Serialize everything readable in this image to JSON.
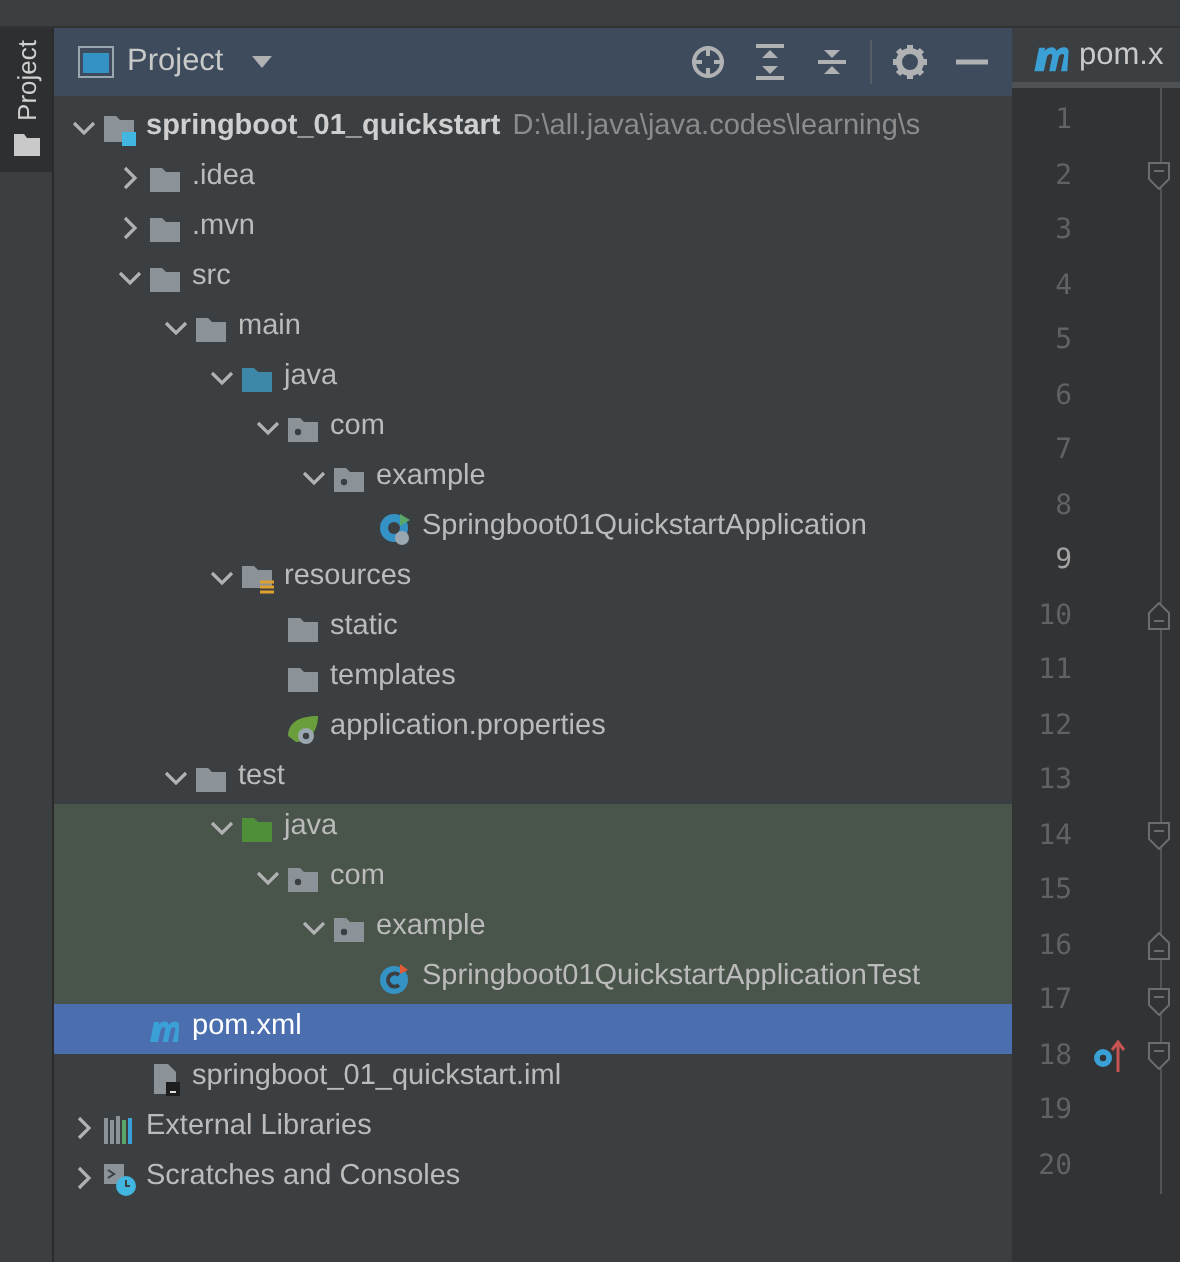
{
  "tool_stripe": {
    "label": "Project"
  },
  "panel": {
    "title": "Project"
  },
  "tree": [
    {
      "kind": "module",
      "label": "springboot_01_quickstart",
      "path": "D:\\all.java\\java.codes\\learning\\s",
      "expanded": true,
      "selected": false,
      "highlighted": false,
      "children": [
        {
          "kind": "folder",
          "label": ".idea",
          "expanded": false,
          "selected": false,
          "highlighted": false
        },
        {
          "kind": "folder",
          "label": ".mvn",
          "expanded": false,
          "selected": false,
          "highlighted": false
        },
        {
          "kind": "folder",
          "label": "src",
          "expanded": true,
          "selected": false,
          "highlighted": false,
          "children": [
            {
              "kind": "folder",
              "label": "main",
              "expanded": true,
              "selected": false,
              "highlighted": false,
              "children": [
                {
                  "kind": "source",
                  "label": "java",
                  "expanded": true,
                  "selected": false,
                  "highlighted": false,
                  "children": [
                    {
                      "kind": "package",
                      "label": "com",
                      "expanded": true,
                      "selected": false,
                      "highlighted": false,
                      "children": [
                        {
                          "kind": "package",
                          "label": "example",
                          "expanded": true,
                          "selected": false,
                          "highlighted": false,
                          "children": [
                            {
                              "kind": "spring-class",
                              "label": "Springboot01QuickstartApplication",
                              "selected": false,
                              "highlighted": false
                            }
                          ]
                        }
                      ]
                    }
                  ]
                },
                {
                  "kind": "resources",
                  "label": "resources",
                  "expanded": true,
                  "selected": false,
                  "highlighted": false,
                  "children": [
                    {
                      "kind": "folder",
                      "label": "static",
                      "selected": false,
                      "highlighted": false
                    },
                    {
                      "kind": "folder",
                      "label": "templates",
                      "selected": false,
                      "highlighted": false
                    },
                    {
                      "kind": "properties",
                      "label": "application.properties",
                      "selected": false,
                      "highlighted": false
                    }
                  ]
                }
              ]
            },
            {
              "kind": "folder",
              "label": "test",
              "expanded": true,
              "selected": false,
              "highlighted": false,
              "children": [
                {
                  "kind": "test-source",
                  "label": "java",
                  "expanded": true,
                  "selected": false,
                  "highlighted": true,
                  "children": [
                    {
                      "kind": "package",
                      "label": "com",
                      "expanded": true,
                      "selected": false,
                      "highlighted": true,
                      "children": [
                        {
                          "kind": "package",
                          "label": "example",
                          "expanded": true,
                          "selected": false,
                          "highlighted": true,
                          "children": [
                            {
                              "kind": "test-class",
                              "label": "Springboot01QuickstartApplicationTest",
                              "selected": false,
                              "highlighted": true
                            }
                          ]
                        }
                      ]
                    }
                  ]
                }
              ]
            }
          ]
        },
        {
          "kind": "maven",
          "label": "pom.xml",
          "selected": true,
          "highlighted": false
        },
        {
          "kind": "iml",
          "label": "springboot_01_quickstart.iml",
          "selected": false,
          "highlighted": false
        }
      ]
    },
    {
      "kind": "libraries",
      "label": "External Libraries",
      "expanded": false,
      "selected": false,
      "highlighted": false
    },
    {
      "kind": "scratches",
      "label": "Scratches and Consoles",
      "expanded": false,
      "selected": false,
      "highlighted": false
    }
  ],
  "editor": {
    "tab": {
      "label": "pom.x"
    },
    "lines": [
      {
        "number": "1",
        "current": false,
        "fold_start": false,
        "fold_end": false,
        "override_marker": false
      },
      {
        "number": "2",
        "current": false,
        "fold_start": true,
        "fold_end": false,
        "override_marker": false
      },
      {
        "number": "3",
        "current": false,
        "fold_start": false,
        "fold_end": false,
        "override_marker": false
      },
      {
        "number": "4",
        "current": false,
        "fold_start": false,
        "fold_end": false,
        "override_marker": false
      },
      {
        "number": "5",
        "current": false,
        "fold_start": false,
        "fold_end": false,
        "override_marker": false
      },
      {
        "number": "6",
        "current": false,
        "fold_start": false,
        "fold_end": false,
        "override_marker": false
      },
      {
        "number": "7",
        "current": false,
        "fold_start": false,
        "fold_end": false,
        "override_marker": false
      },
      {
        "number": "8",
        "current": false,
        "fold_start": false,
        "fold_end": false,
        "override_marker": false
      },
      {
        "number": "9",
        "current": true,
        "fold_start": false,
        "fold_end": false,
        "override_marker": false
      },
      {
        "number": "10",
        "current": false,
        "fold_start": false,
        "fold_end": true,
        "override_marker": false
      },
      {
        "number": "11",
        "current": false,
        "fold_start": false,
        "fold_end": false,
        "override_marker": false
      },
      {
        "number": "12",
        "current": false,
        "fold_start": false,
        "fold_end": false,
        "override_marker": false
      },
      {
        "number": "13",
        "current": false,
        "fold_start": false,
        "fold_end": false,
        "override_marker": false
      },
      {
        "number": "14",
        "current": false,
        "fold_start": true,
        "fold_end": false,
        "override_marker": false
      },
      {
        "number": "15",
        "current": false,
        "fold_start": false,
        "fold_end": false,
        "override_marker": false
      },
      {
        "number": "16",
        "current": false,
        "fold_start": false,
        "fold_end": true,
        "override_marker": false
      },
      {
        "number": "17",
        "current": false,
        "fold_start": true,
        "fold_end": false,
        "override_marker": false
      },
      {
        "number": "18",
        "current": false,
        "fold_start": true,
        "fold_end": false,
        "override_marker": true
      },
      {
        "number": "19",
        "current": false,
        "fold_start": false,
        "fold_end": false,
        "override_marker": false
      },
      {
        "number": "20",
        "current": false,
        "fold_start": false,
        "fold_end": false,
        "override_marker": false
      }
    ]
  }
}
